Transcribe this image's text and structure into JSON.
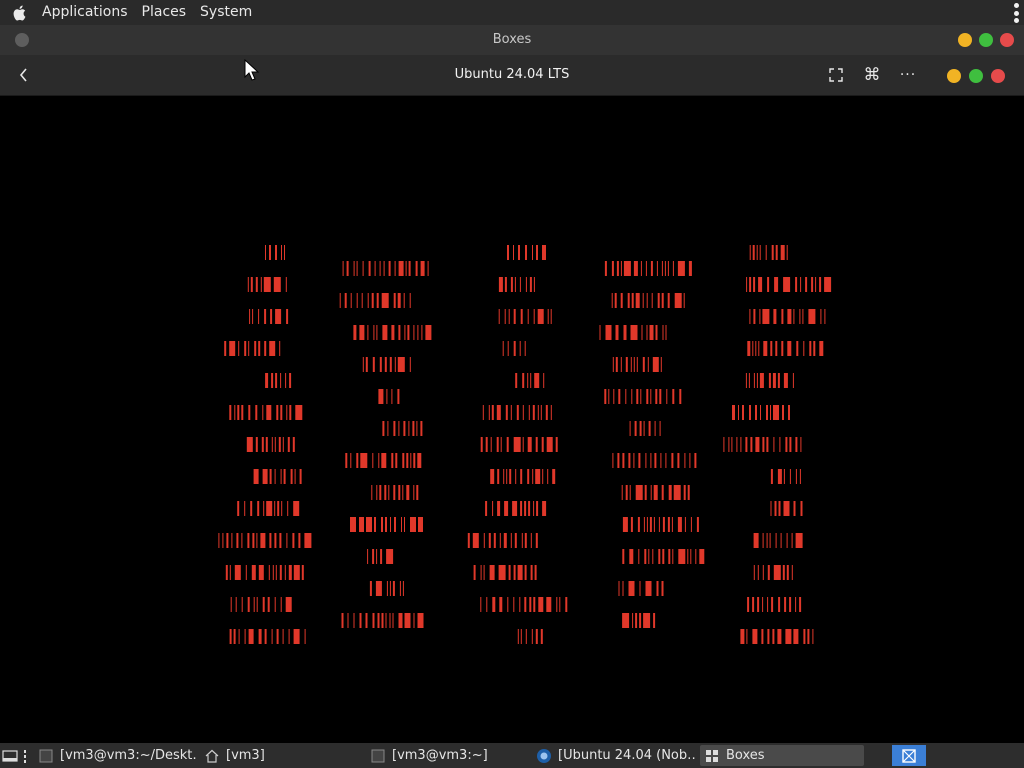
{
  "top_panel": {
    "menus": [
      "Applications",
      "Places",
      "System"
    ]
  },
  "window": {
    "title": "Boxes",
    "headerbar_title": "Ubuntu 24.04 LTS",
    "buttons": {
      "back": "back-arrow",
      "fullscreen": "fullscreen-icon",
      "keys": "keyboard-shortcuts-icon",
      "more": "more-options-icon"
    },
    "colors": {
      "minimize": "#f1b324",
      "maximize": "#3fbf3f",
      "close": "#e64b4b"
    }
  },
  "vm_display": {
    "glyph_color": "#e0382a"
  },
  "taskbar": {
    "tasks": [
      {
        "label": "[vm3@vm3:~/Deskt…",
        "icon": "terminal-icon"
      },
      {
        "label": "[vm3]",
        "icon": "home-folder-icon"
      },
      {
        "label": "[vm3@vm3:~]",
        "icon": "terminal-icon"
      },
      {
        "label": "[Ubuntu 24.04 (Nob…",
        "icon": "browser-icon"
      },
      {
        "label": "Boxes",
        "icon": "boxes-icon"
      }
    ],
    "active_task": "Boxes",
    "accent_color": "#3b7fd6"
  }
}
